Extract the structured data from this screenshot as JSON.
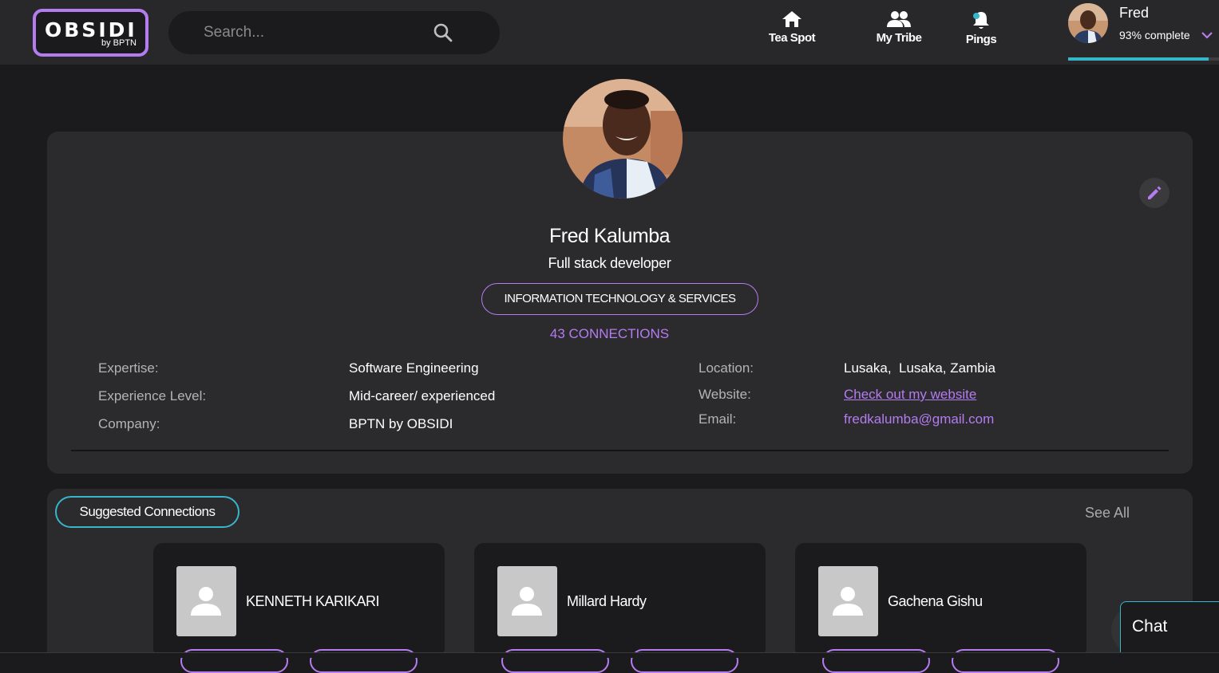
{
  "logo": {
    "main": "OBSIDI",
    "sub": "by BPTN"
  },
  "search": {
    "placeholder": "Search..."
  },
  "nav": [
    {
      "label": "Tea Spot",
      "icon": "home-icon"
    },
    {
      "label": "My Tribe",
      "icon": "people-icon"
    },
    {
      "label": "Pings",
      "icon": "bell-icon"
    }
  ],
  "user": {
    "name": "Fred",
    "complete": "93% complete",
    "progress": 0.93
  },
  "profile": {
    "name": "Fred Kalumba",
    "title": "Full stack developer",
    "industry": "INFORMATION TECHNOLOGY & SERVICES",
    "connections": "43 CONNECTIONS",
    "details_left": [
      {
        "label": "Expertise:",
        "value": "Software Engineering"
      },
      {
        "label": "Experience Level:",
        "value": "Mid-career/ experienced"
      },
      {
        "label": "Company:",
        "value": "BPTN by OBSIDI"
      }
    ],
    "details_right": [
      {
        "label": "Location:",
        "value": "Lusaka,  Lusaka, Zambia"
      },
      {
        "label": "Website:",
        "value": "Check out my website"
      },
      {
        "label": "Email:",
        "value": "fredkalumba@gmail.com"
      }
    ]
  },
  "suggested": {
    "title": "Suggested Connections",
    "see_all": "See All",
    "people": [
      "KENNETH KARIKARI",
      "Millard Hardy",
      "Gachena Gishu"
    ]
  },
  "chat": {
    "label": "Chat"
  },
  "colors": {
    "accent_purple": "#b57cf0",
    "accent_teal": "#36b6c9",
    "bg": "#1b1a1d",
    "card": "#2b2a2d"
  }
}
